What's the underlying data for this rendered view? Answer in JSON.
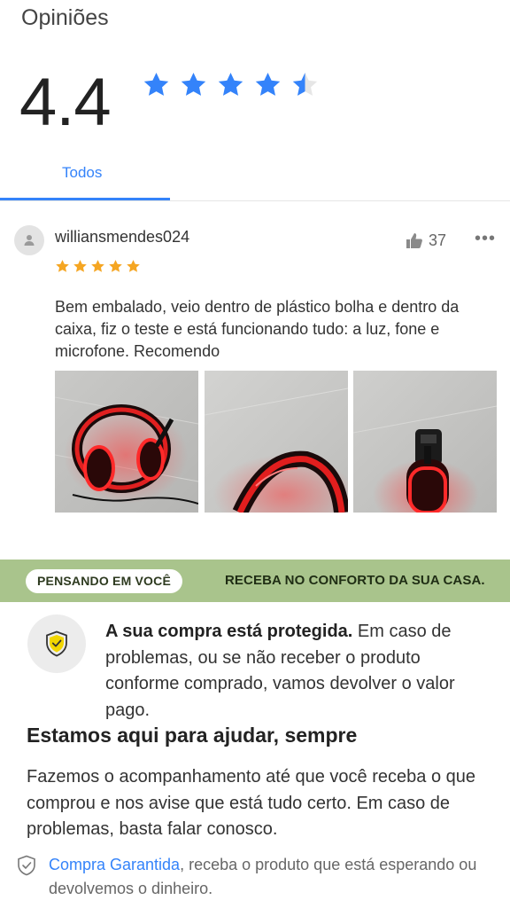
{
  "reviews": {
    "title": "Opiniões",
    "average": "4.4",
    "average_stars": 4.4,
    "tabs": [
      {
        "label": "Todos",
        "active": true
      }
    ]
  },
  "review": {
    "username": "williansmendes024",
    "likes": "37",
    "stars": 5,
    "text": "Bem embalado, veio dentro de plástico bolha e dentro da caixa, fiz o teste e está funcionando tudo: a luz, fone e microfone. Recomendo",
    "photos": [
      "headset-photo",
      "headset-photo",
      "headset-photo"
    ]
  },
  "banner": {
    "pill": "PENSANDO EM VOCÊ",
    "text": "RECEBA NO CONFORTO DA SUA CASA."
  },
  "protection": {
    "bold": "A sua compra está protegida.",
    "text": " Em caso de problemas, ou se não receber o produto conforme comprado, vamos devolver o valor pago."
  },
  "help": {
    "title": "Estamos aqui para ajudar, sempre",
    "text": "Fazemos o acompanhamento até que você receba o que comprou e nos avise que está tudo certo. Em caso de problemas, basta falar conosco."
  },
  "guarantee": {
    "link": "Compra Garantida",
    "text": ", receba o produto que está esperando ou devolvemos o dinheiro."
  },
  "colors": {
    "accent": "#3483fa",
    "banner": "#a9c48c",
    "star_small": "#f5a623",
    "shield": "#f2d600"
  },
  "icons": [
    "star-icon",
    "user-icon",
    "thumbs-up-icon",
    "more-icon",
    "shield-check-icon"
  ]
}
